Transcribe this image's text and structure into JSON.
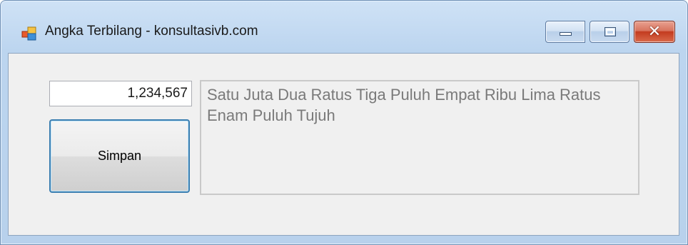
{
  "window": {
    "title": "Angka Terbilang - konsultasivb.com",
    "icon": "form-icon",
    "controls": {
      "minimize": "minimize-icon",
      "maximize": "maximize-icon",
      "close": "✕"
    }
  },
  "form": {
    "number_value": "1,234,567",
    "save_label": "Simpan",
    "result_text": "Satu Juta Dua Ratus Tiga Puluh Empat Ribu Lima Ratus Enam Puluh Tujuh"
  },
  "colors": {
    "titlebar": "#bcd5ef",
    "client_background": "#f0f0f0",
    "close_button": "#c33b1f",
    "button_focus_border": "#3c7fb1",
    "result_text": "#7a7a7a"
  }
}
